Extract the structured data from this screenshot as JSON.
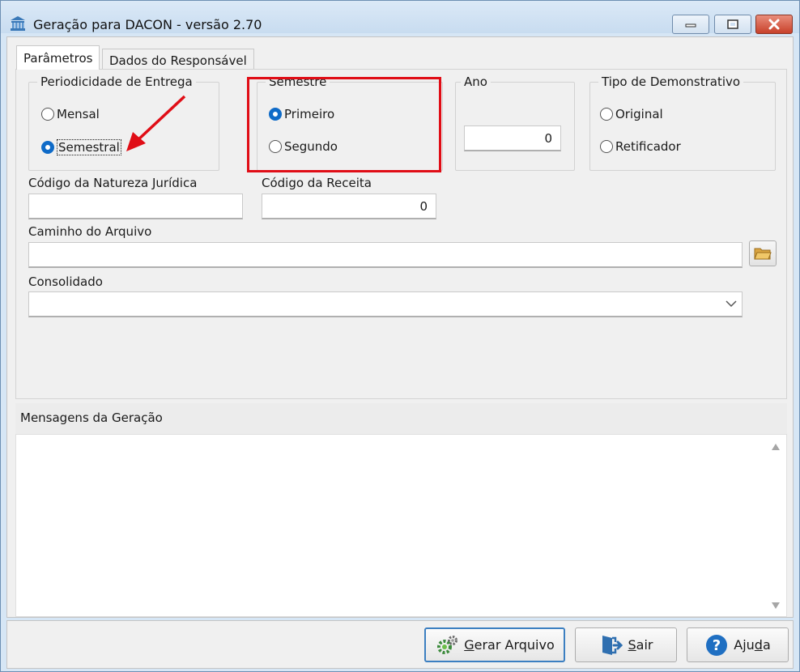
{
  "window": {
    "title": "Geração para DACON - versão 2.70",
    "controls": [
      "minimize",
      "maximize",
      "close"
    ]
  },
  "tabs": [
    {
      "label": "Parâmetros",
      "active": true
    },
    {
      "label": "Dados do Responsável",
      "active": false
    }
  ],
  "periodicidade": {
    "label": "Periodicidade de Entrega",
    "options": [
      {
        "label": "Mensal",
        "selected": false
      },
      {
        "label": "Semestral",
        "selected": true
      }
    ]
  },
  "semestre": {
    "label": "Semestre",
    "options": [
      {
        "label": "Primeiro",
        "selected": true
      },
      {
        "label": "Segundo",
        "selected": false
      }
    ]
  },
  "ano": {
    "label": "Ano",
    "value": "0"
  },
  "tipo": {
    "label": "Tipo de Demonstrativo",
    "options": [
      {
        "label": "Original",
        "selected": false
      },
      {
        "label": "Retificador",
        "selected": false
      }
    ]
  },
  "natureza": {
    "label": "Código da Natureza Jurídica",
    "value": ""
  },
  "receita": {
    "label": "Código da Receita",
    "value": "0"
  },
  "caminho": {
    "label": "Caminho do Arquivo",
    "value": "",
    "button_icon": "folder-icon"
  },
  "consolidado": {
    "label": "Consolidado",
    "value": ""
  },
  "mensagens": {
    "label": "Mensagens da Geração"
  },
  "buttons": {
    "gerar": {
      "label_accel": "G",
      "label_rest": "erar Arquivo",
      "icon": "gears-icon"
    },
    "sair": {
      "label_accel": "S",
      "label_rest": "air",
      "icon": "exit-icon"
    },
    "ajuda": {
      "label_pre": "Aju",
      "label_accel": "d",
      "label_rest": "a",
      "icon": "help-icon"
    }
  },
  "colors": {
    "accent": "#0f6bc8",
    "highlight": "#e00d16",
    "close_button": "#c8412a"
  }
}
